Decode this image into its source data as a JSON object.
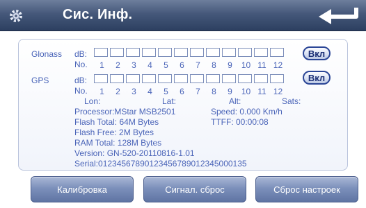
{
  "header": {
    "title": "Сис. Инф.",
    "icons": {
      "settings": "gear-icon",
      "back": "back-arrow-icon"
    }
  },
  "glonass": {
    "label": "Glonass",
    "db_label": "dB:",
    "no_label": "No.",
    "channels": [
      "1",
      "2",
      "3",
      "4",
      "5",
      "6",
      "7",
      "8",
      "9",
      "10",
      "11",
      "12"
    ],
    "button": "Вкл"
  },
  "gps": {
    "label": "GPS",
    "db_label": "dB:",
    "no_label": "No.",
    "channels": [
      "1",
      "2",
      "3",
      "4",
      "5",
      "6",
      "7",
      "8",
      "9",
      "10",
      "11",
      "12"
    ],
    "button": "Вкл"
  },
  "position": {
    "lon": "Lon:",
    "lat": "Lat:",
    "alt": "Alt:",
    "sats": "Sats:"
  },
  "info": {
    "processor": "Processor:MStar MSB2501",
    "speed": "Speed: 0.000 Km/h",
    "flash_total": "Flash Total: 64M Bytes",
    "ttff": "TTFF: 00:00:08",
    "flash_free": "Flash Free: 2M Bytes",
    "ram_total": "RAM Total: 128M Bytes",
    "version": "Version: GN-520-20110816-1.01",
    "serial": "Serial:01234567890123456789012345000135"
  },
  "buttons": {
    "calibration": "Калибровка",
    "signal_reset": "Сигнал. сброс",
    "settings_reset": "Сброс настроек"
  },
  "colors": {
    "title_bar": "#45587a",
    "text_blue": "#4a64b8",
    "button_blue": "#7c90bb",
    "on_button_border": "#2a4596"
  }
}
